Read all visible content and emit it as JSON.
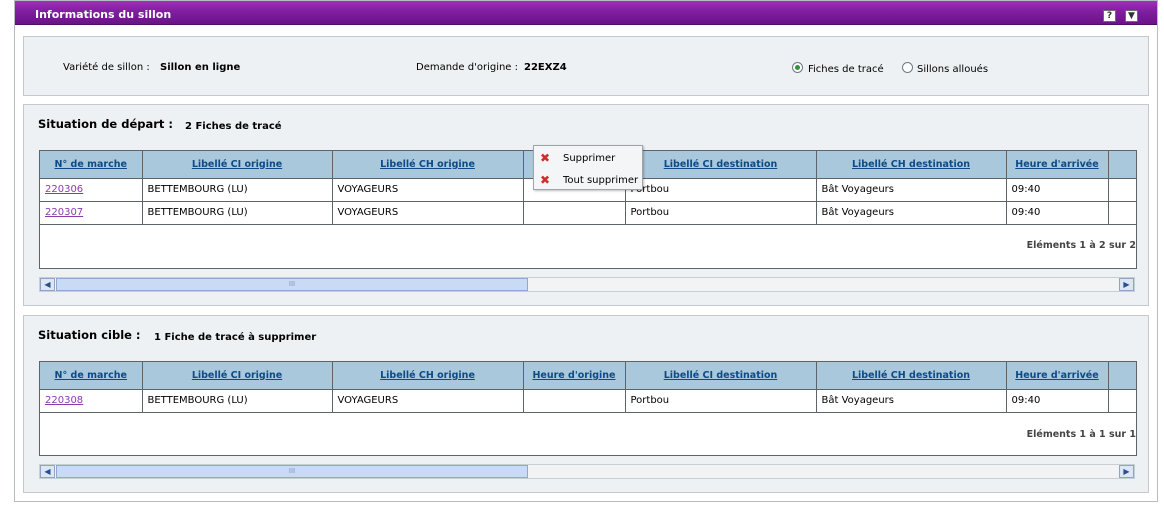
{
  "header": {
    "title": "Informations du sillon",
    "help_icon": "help-icon",
    "collapse_icon": "chevron-down-icon"
  },
  "info": {
    "variete_label": "Variété de sillon :",
    "variete_value": "Sillon en ligne",
    "demande_label": "Demande d'origine :",
    "demande_value": "22EXZ4",
    "radio_fiches": "Fiches de tracé",
    "radio_sillons": "Sillons alloués",
    "selected": "Fiches de tracé"
  },
  "columns": [
    "N° de marche",
    "Libellé CI origine",
    "Libellé CH origine",
    "Heure d'origine",
    "Libellé CI destination",
    "Libellé CH destination",
    "Heure d'arrivée"
  ],
  "depart": {
    "title": "Situation de départ :",
    "subtitle": "2 Fiches de tracé",
    "rows": [
      [
        "220306",
        "BETTEMBOURG (LU)",
        "VOYAGEURS",
        "",
        "Portbou",
        "Bât Voyageurs",
        "09:40"
      ],
      [
        "220307",
        "BETTEMBOURG (LU)",
        "VOYAGEURS",
        "",
        "Portbou",
        "Bât Voyageurs",
        "09:40"
      ]
    ],
    "footer": "Eléments 1 à 2 sur 2"
  },
  "cible": {
    "title": "Situation cible :",
    "subtitle": "1 Fiche de tracé à supprimer",
    "rows": [
      [
        "220308",
        "BETTEMBOURG (LU)",
        "VOYAGEURS",
        "",
        "Portbou",
        "Bât Voyageurs",
        "09:40"
      ]
    ],
    "footer": "Eléments 1 à 1 sur 1"
  },
  "context_menu": {
    "items": [
      {
        "label": "Supprimer",
        "icon": "delete-icon"
      },
      {
        "label": "Tout supprimer",
        "icon": "delete-icon"
      }
    ]
  },
  "scrollbar": {
    "left_arrow": "◀",
    "right_arrow": "▶",
    "grip": "III"
  },
  "colors": {
    "titlebar": "#801ea0",
    "header_bg": "#a9c8dc",
    "link": "#8a3cae",
    "delete": "#d42b2b"
  }
}
